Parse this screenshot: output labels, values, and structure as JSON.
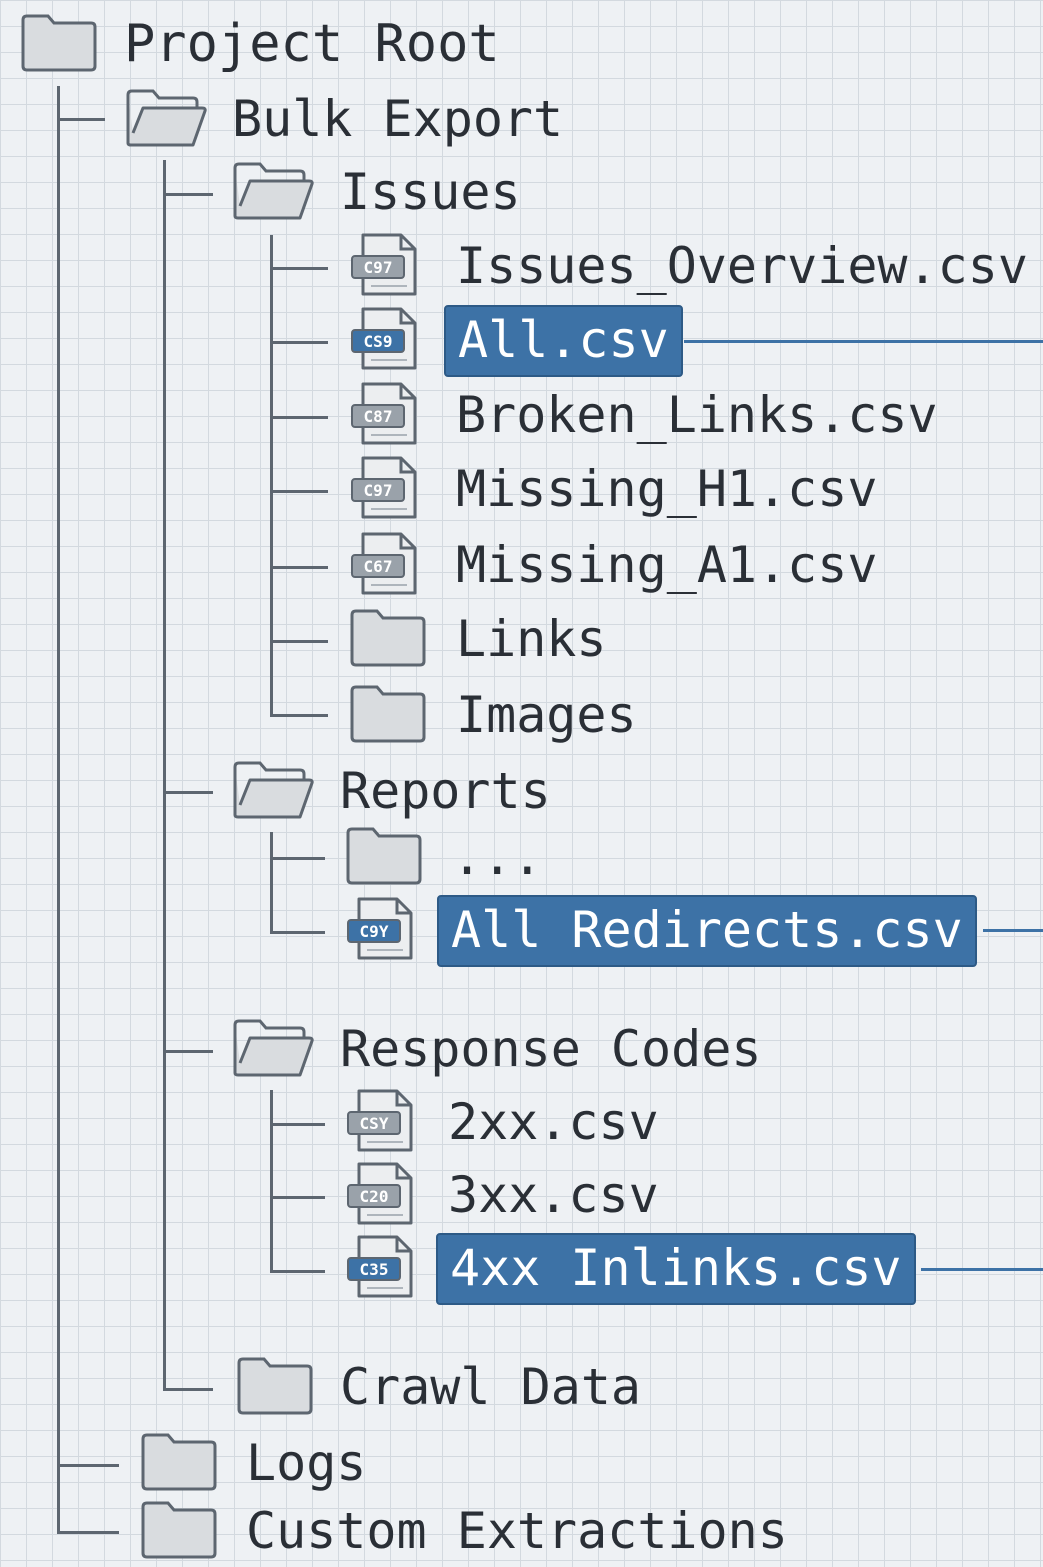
{
  "tree": [
    {
      "label": "Project Root",
      "kind": "folder-closed"
    },
    {
      "label": "Bulk Export",
      "kind": "folder-open"
    },
    {
      "label": "Issues",
      "kind": "folder-open"
    },
    {
      "label": "Issues_Overview.csv",
      "kind": "file",
      "icon_text": "C97"
    },
    {
      "label": "All.csv",
      "kind": "file",
      "icon_text": "CS9",
      "selected": true
    },
    {
      "label": "Broken_Links.csv",
      "kind": "file",
      "icon_text": "C87"
    },
    {
      "label": "Missing_H1.csv",
      "kind": "file",
      "icon_text": "C97"
    },
    {
      "label": "Missing_A1.csv",
      "kind": "file",
      "icon_text": "C67"
    },
    {
      "label": "Links",
      "kind": "folder-closed"
    },
    {
      "label": "Images",
      "kind": "folder-closed"
    },
    {
      "label": "Reports",
      "kind": "folder-open"
    },
    {
      "label": "...",
      "kind": "folder-closed"
    },
    {
      "label": "All Redirects.csv",
      "kind": "file",
      "icon_text": "C9Y",
      "selected": true
    },
    {
      "label": "Response Codes",
      "kind": "folder-open"
    },
    {
      "label": "2xx.csv",
      "kind": "file",
      "icon_text": "CSY"
    },
    {
      "label": "3xx.csv",
      "kind": "file",
      "icon_text": "C20"
    },
    {
      "label": "4xx Inlinks.csv",
      "kind": "file",
      "icon_text": "C35",
      "selected": true
    },
    {
      "label": "Crawl Data",
      "kind": "folder-closed"
    },
    {
      "label": "Logs",
      "kind": "folder-closed"
    },
    {
      "label": "Custom Extractions",
      "kind": "folder-closed"
    }
  ],
  "colors": {
    "selection": "#3d72a6",
    "line": "#5d6670",
    "icon_fill": "#d9dcdf",
    "icon_stroke": "#5d6670",
    "background": "#eef1f4"
  }
}
